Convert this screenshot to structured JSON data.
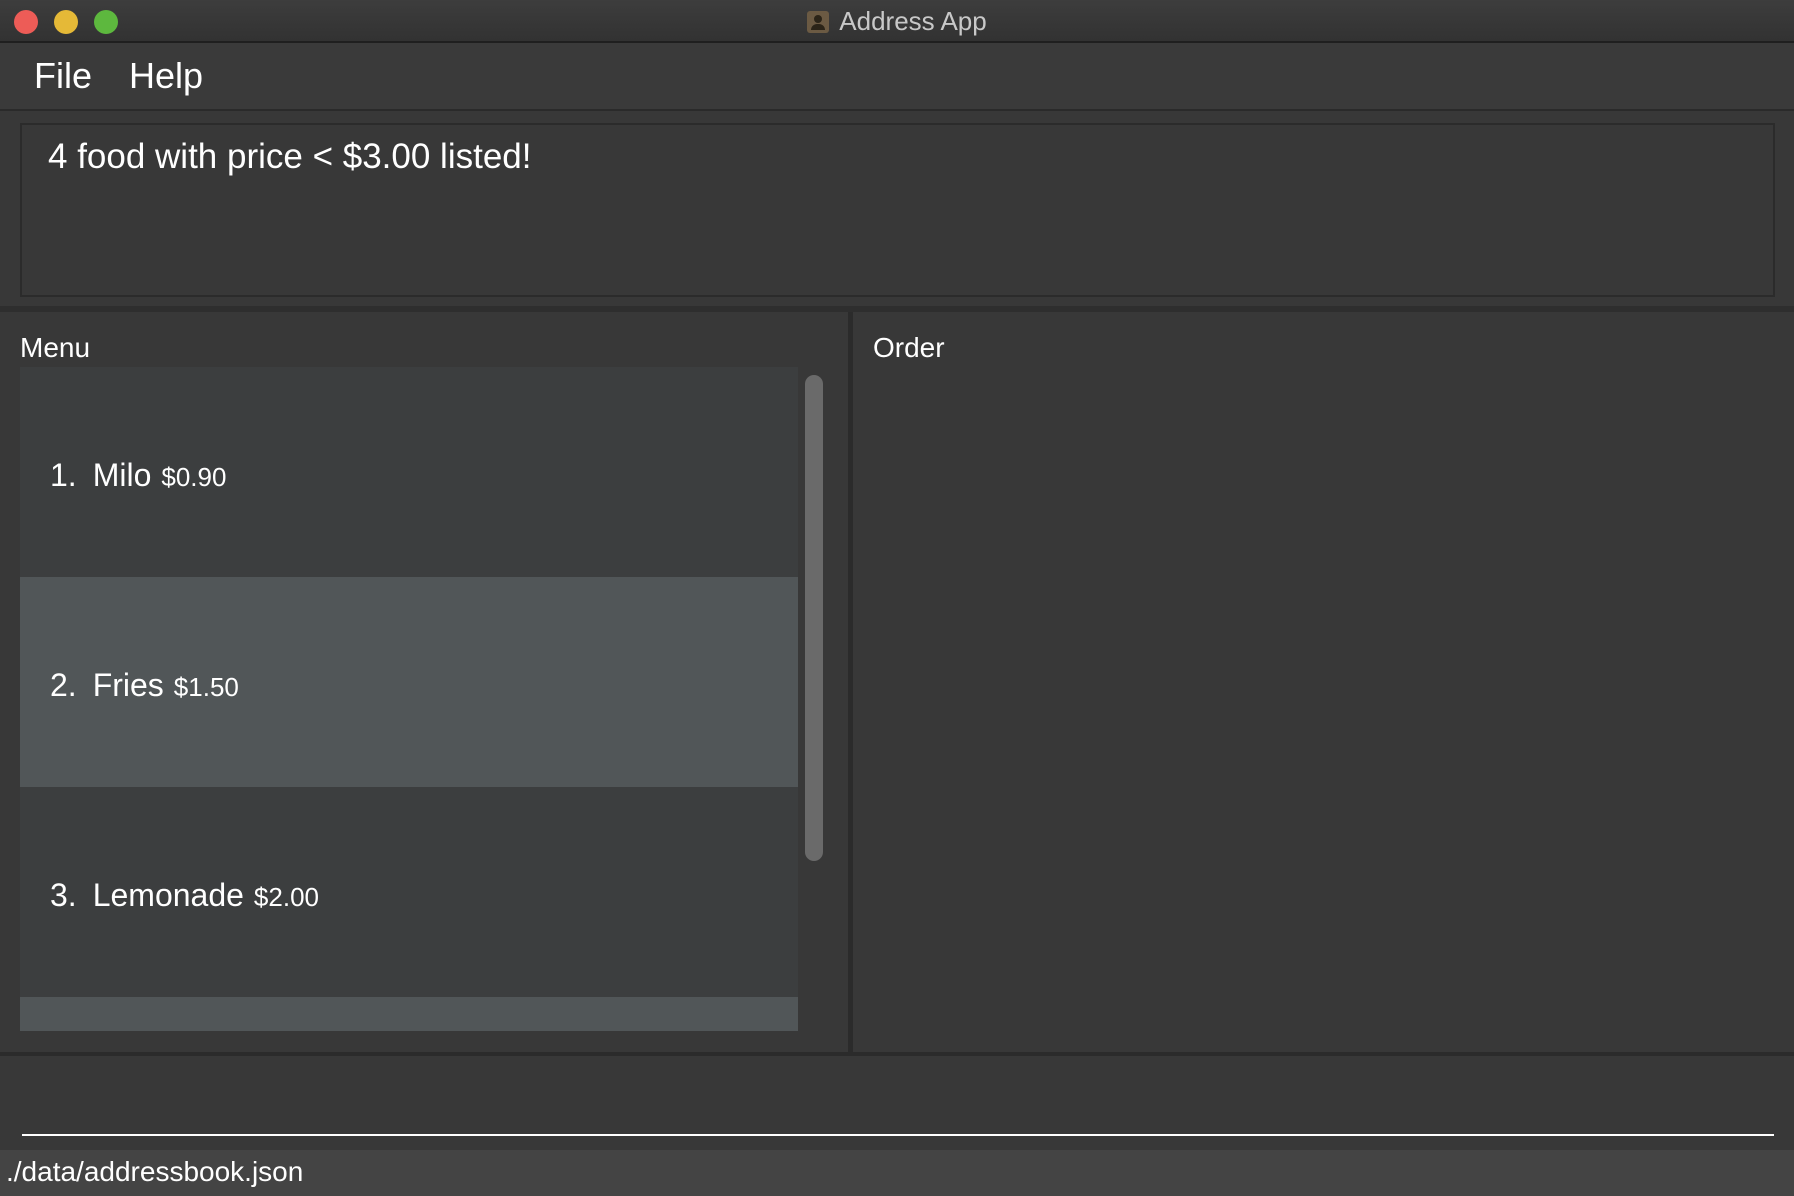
{
  "window": {
    "title": "Address App",
    "title_icon": "contact-card-icon",
    "controls": [
      "close",
      "minimize",
      "maximize"
    ]
  },
  "menubar": {
    "file_label": "File",
    "help_label": "Help"
  },
  "result": {
    "message": "4 food with price < $3.00 listed!"
  },
  "menu_panel": {
    "title": "Menu",
    "items": [
      {
        "index": "1.",
        "name": "Milo",
        "price": "$0.90"
      },
      {
        "index": "2.",
        "name": "Fries",
        "price": "$1.50"
      },
      {
        "index": "3.",
        "name": "Lemonade",
        "price": "$2.00"
      }
    ]
  },
  "order_panel": {
    "title": "Order"
  },
  "command": {
    "value": "",
    "placeholder": ""
  },
  "statusbar": {
    "file_path": "./data/addressbook.json"
  },
  "colors": {
    "background": "#383838",
    "list_odd": "#3c3e3f",
    "list_even": "#515658",
    "close_button": "#ed5c57",
    "minimize_button": "#e5b937",
    "maximize_button": "#5db83e"
  }
}
